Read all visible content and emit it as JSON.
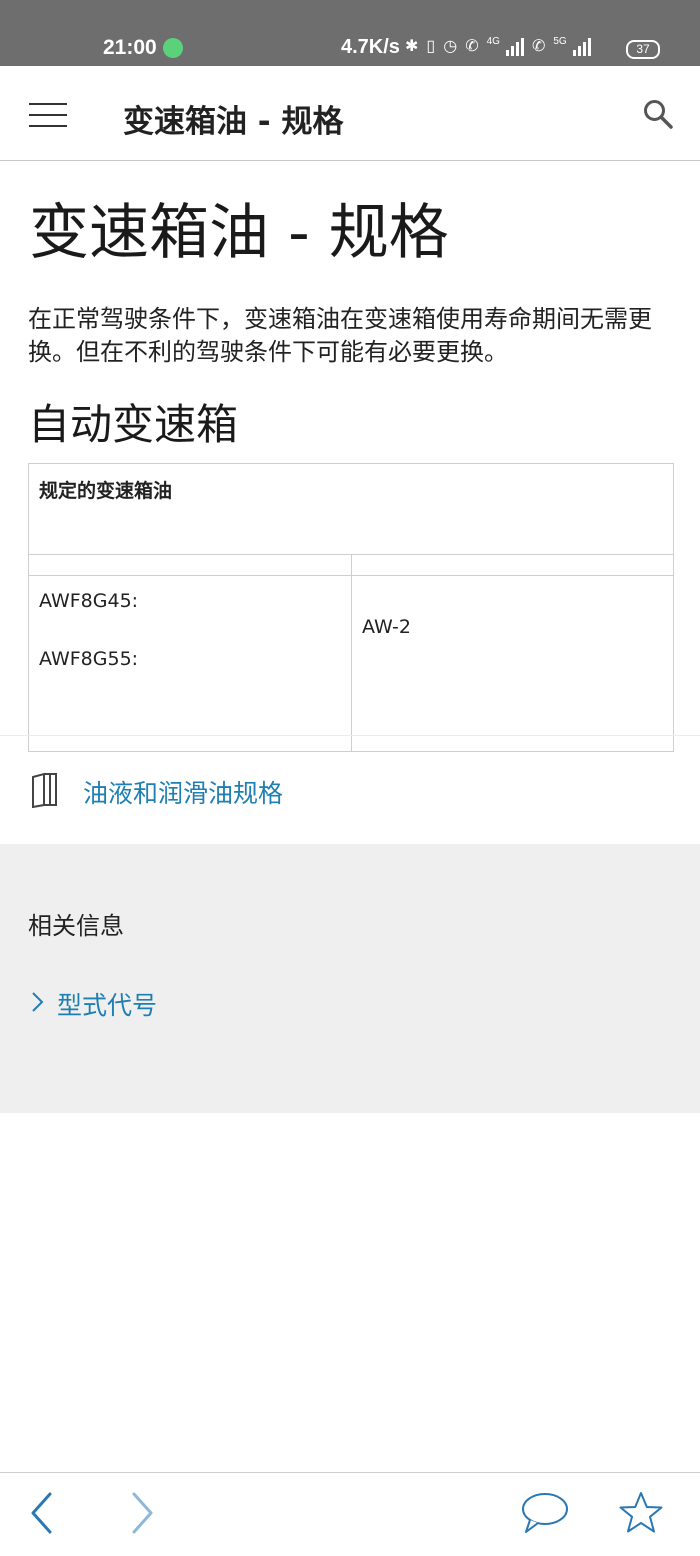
{
  "status_bar": {
    "time": "21:00",
    "net_speed": "4.7K/s",
    "sim1_tag": "4G",
    "sim2_tag": "5G",
    "battery": "37",
    "icons": [
      "app-notification-icon",
      "bluetooth-icon",
      "vibrate-icon",
      "alarm-icon",
      "call-icon",
      "signal-icon",
      "call-icon",
      "signal-icon",
      "battery-icon"
    ]
  },
  "app_bar": {
    "title": "变速箱油 - 规格",
    "menu_icon": "menu-icon",
    "search_icon": "search-icon"
  },
  "content": {
    "page_title": "变速箱油 - 规格",
    "intro": "在正常驾驶条件下，变速箱油在变速箱使用寿命期间无需更换。但在不利的驾驶条件下可能有必要更换。",
    "section_title": "自动变速箱",
    "table": {
      "header": "规定的变速箱油",
      "models": [
        "AWF8G45:",
        "AWF8G55:"
      ],
      "oil": "AW-2"
    },
    "doc_link": {
      "icon": "book-icon",
      "label": "油液和润滑油规格"
    }
  },
  "related": {
    "heading": "相关信息",
    "links": [
      {
        "label": "型式代号",
        "icon": "chevron-right-icon"
      }
    ]
  },
  "bottom_bar": {
    "icons": [
      "back-arrow-icon",
      "forward-arrow-icon",
      "comment-icon",
      "favorite-star-icon"
    ]
  },
  "colors": {
    "status_bar": "#6e6e6e",
    "link": "#1f7fb2",
    "related_bg": "#efefef",
    "icon_blue": "#2a78b3"
  }
}
